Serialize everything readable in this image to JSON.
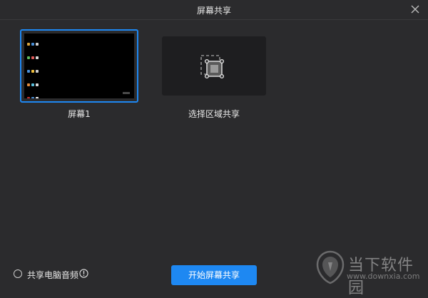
{
  "window": {
    "title": "屏幕共享"
  },
  "sources": [
    {
      "label": "屏幕1",
      "selected": true
    },
    {
      "label": "选择区域共享",
      "selected": false
    }
  ],
  "footer": {
    "share_audio_label": "共享电脑音频",
    "share_audio_checked": false,
    "start_button_label": "开始屏幕共享"
  },
  "watermark": {
    "brand_text": "当下软件园",
    "url": "www.downxia.com"
  },
  "colors": {
    "background": "#2b2b2d",
    "accent": "#1e88f2",
    "tile_bg": "#1e1e20"
  },
  "icons": {
    "close": "close-icon",
    "region": "region-select-icon",
    "info": "info-icon",
    "watermark_logo": "downxia-logo-icon"
  }
}
